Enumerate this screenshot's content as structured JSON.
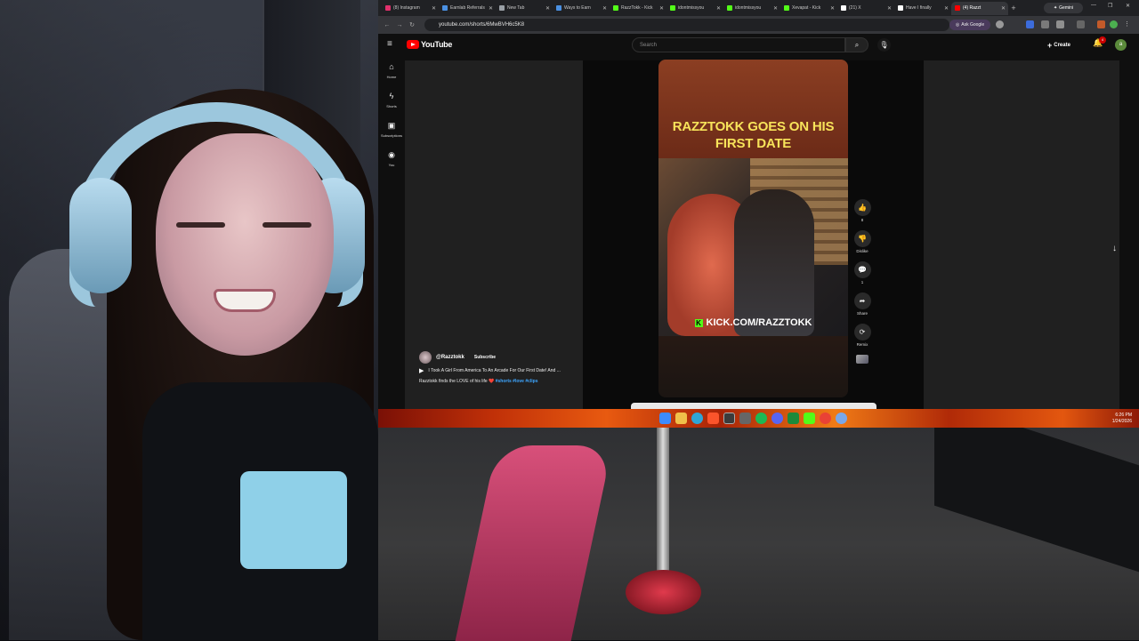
{
  "browser": {
    "tabs": [
      {
        "label": "(8) Instagram",
        "icon": "instagram-icon",
        "color": "#e1306c"
      },
      {
        "label": "Earnlab Referrals",
        "icon": "earnlab-icon",
        "color": "#4a90e2"
      },
      {
        "label": "New Tab",
        "icon": "chrome-icon",
        "color": "#9aa0a6"
      },
      {
        "label": "Ways to Earn",
        "icon": "earnlab-icon",
        "color": "#4a90e2"
      },
      {
        "label": "RazzTokk - Kick",
        "icon": "kick-icon",
        "color": "#53fc18"
      },
      {
        "label": "idontmissyou",
        "icon": "kick-icon",
        "color": "#53fc18"
      },
      {
        "label": "idontmissyou",
        "icon": "kick-icon",
        "color": "#53fc18"
      },
      {
        "label": "Xevapat - Kick",
        "icon": "kick-icon",
        "color": "#53fc18"
      },
      {
        "label": "(21) X",
        "icon": "x-icon",
        "color": "#ffffff"
      },
      {
        "label": "Have I finally",
        "icon": "tiktok-icon",
        "color": "#ffffff"
      },
      {
        "label": "(4) Razzt",
        "icon": "youtube-icon",
        "color": "#ff0000"
      }
    ],
    "new_tab_label": "+",
    "gemini_label": "Gemini",
    "url": "youtube.com/shorts/6MwBVH6c5K8",
    "ask_google_label": "Ask Google"
  },
  "youtube": {
    "logo_text": "YouTube",
    "search_placeholder": "Search",
    "create_label": "Create",
    "notification_count": "4",
    "avatar_letter": "a",
    "sidebar": [
      {
        "label": "Home",
        "icon": "home-icon"
      },
      {
        "label": "Shorts",
        "icon": "shorts-icon"
      },
      {
        "label": "Subscriptions",
        "icon": "subscriptions-icon"
      },
      {
        "label": "You",
        "icon": "you-icon"
      }
    ],
    "short": {
      "overlay_title_line1": "RAZZTOKK GOES ON HIS",
      "overlay_title_line2": "FIRST DATE",
      "kick_text": "KICK.COM/RAZZTOKK",
      "channel": "@Razztokk",
      "subscribe_label": "Subscribe",
      "title": "I Took A Girl From America To An Arcade For Our First Date! And ...",
      "description": "Razztokk finds the LOVE of his life",
      "heart": "❤️",
      "hashtags": "#shorts #love #clips"
    },
    "actions": [
      {
        "label": "8",
        "icon": "like-icon"
      },
      {
        "label": "Dislike",
        "icon": "dislike-icon"
      },
      {
        "label": "1",
        "icon": "comment-icon"
      },
      {
        "label": "Share",
        "icon": "share-icon"
      },
      {
        "label": "Remix",
        "icon": "remix-icon"
      }
    ]
  },
  "taskbar": {
    "time": "6:26 PM",
    "date": "1/24/2026"
  },
  "colors": {
    "youtube_red": "#ff0000",
    "kick_green": "#53fc18",
    "overlay_yellow": "#f7e35a",
    "hashtag_blue": "#3ea6ff"
  }
}
